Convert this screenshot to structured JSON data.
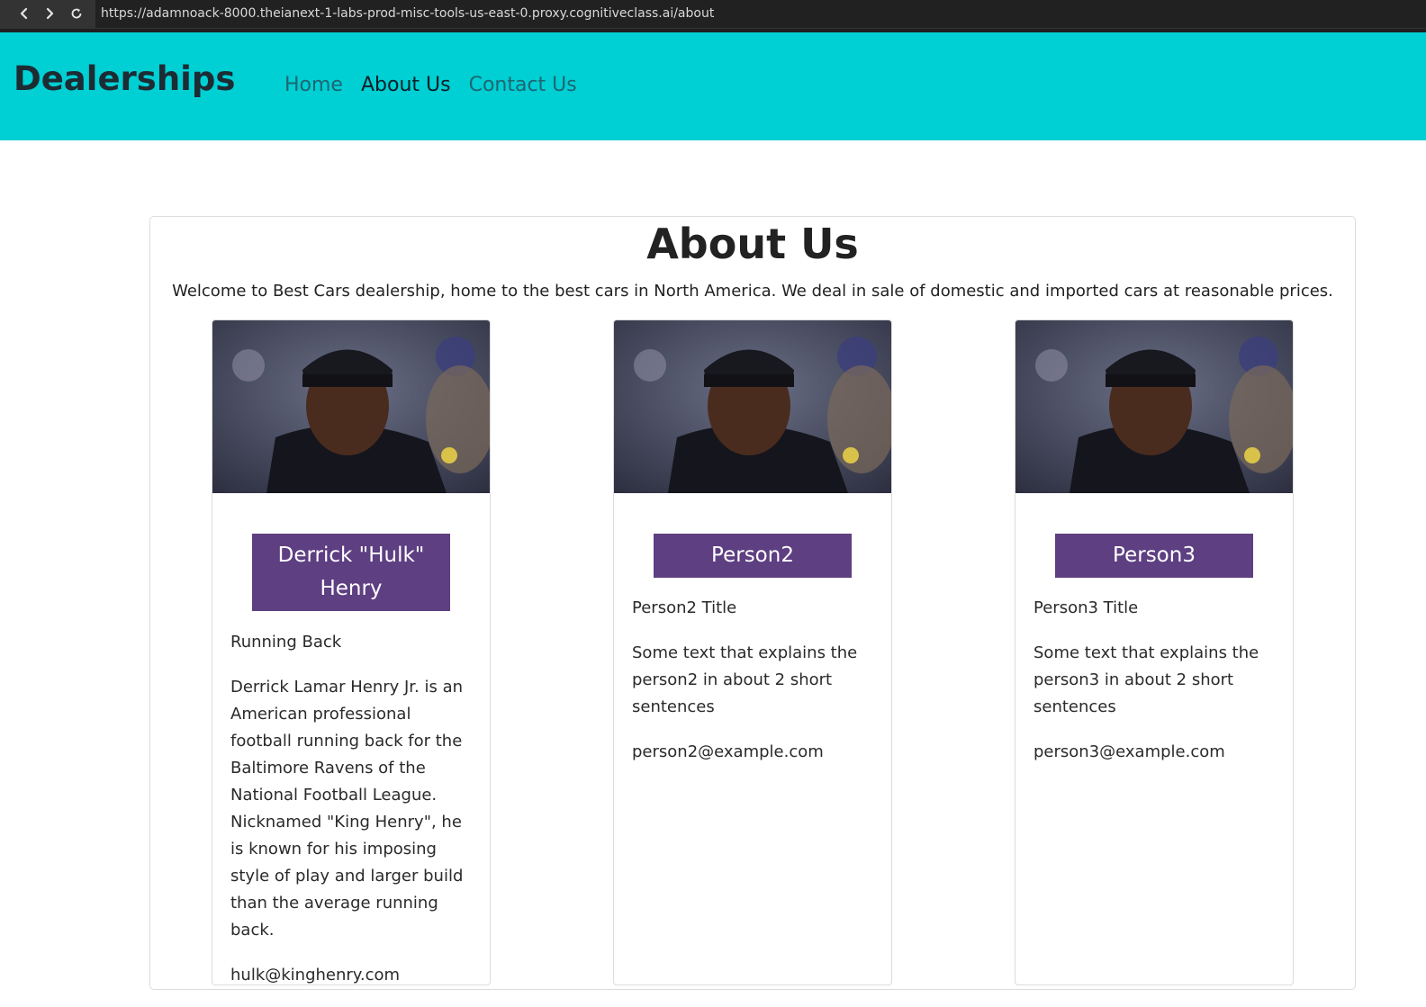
{
  "browser": {
    "url": "https://adamnoack-8000.theianext-1-labs-prod-misc-tools-us-east-0.proxy.cognitiveclass.ai/about"
  },
  "navbar": {
    "brand": "Dealerships",
    "links": [
      {
        "label": "Home",
        "active": false
      },
      {
        "label": "About Us",
        "active": true
      },
      {
        "label": "Contact Us",
        "active": false
      }
    ],
    "background": "#00cfd3"
  },
  "main": {
    "title": "About Us",
    "intro": "Welcome to Best Cars dealership, home to the best cars in North America. We deal in sale of domestic and imported cars at reasonable prices.",
    "people": [
      {
        "name": "Derrick \"Hulk\" Henry",
        "title": "Running Back",
        "description": "Derrick Lamar Henry Jr. is an American professional football running back for the Baltimore Ravens of the National Football League. Nicknamed \"King Henry\", he is known for his imposing style of play and larger build than the average running back.",
        "email": "hulk@kinghenry.com"
      },
      {
        "name": "Person2",
        "title": "Person2 Title",
        "description": "Some text that explains the person2 in about 2 short sentences",
        "email": "person2@example.com"
      },
      {
        "name": "Person3",
        "title": "Person3 Title",
        "description": "Some text that explains the person3 in about 2 short sentences",
        "email": "person3@example.com"
      }
    ],
    "badge_color": "#5e3f82"
  }
}
